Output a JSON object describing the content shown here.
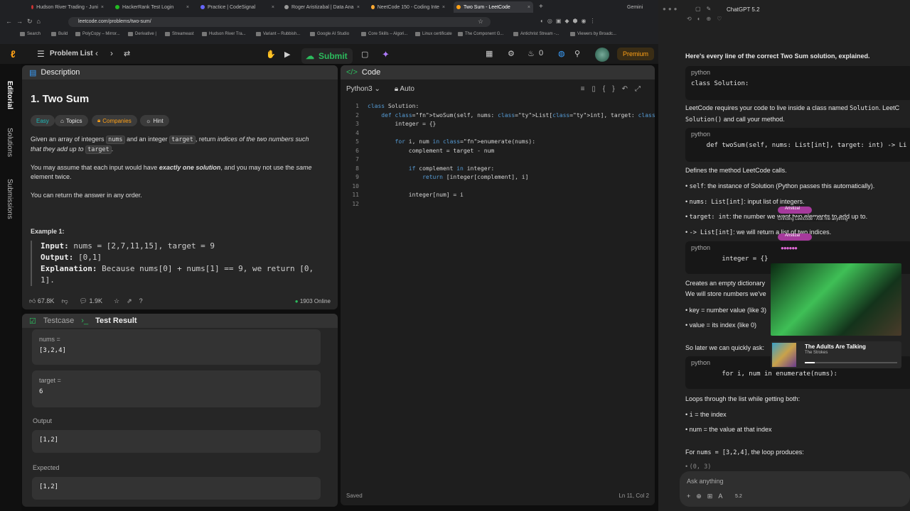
{
  "browser": {
    "tabs": [
      "Hudson River Trading - Juni",
      "HackerRank Test Login",
      "Practice | CodeSignal",
      "Roger Aristizabal | Data Ana",
      "NeetCode 150 - Coding Inte",
      "Two Sum - LeetCode"
    ],
    "extra_tab": "Gemini",
    "url": "leetcode.com/problems/two-sum/",
    "bookmarks": [
      "Search",
      "Build",
      "PolyCopy – Mirror...",
      "Derivative |",
      "Streameast",
      "Hudson River Tra...",
      "Variant – Rubbish...",
      "Google AI Studio",
      "Core Skills – Algori...",
      "Linux certificate",
      "The Component G...",
      "Antichrist Stream -...",
      "Viewers by Broadc..."
    ]
  },
  "nav": {
    "problem_list": "Problem List",
    "submit": "Submit",
    "streak": "0",
    "premium": "Premium"
  },
  "rail": {
    "editorial": "Editorial",
    "solutions": "Solutions",
    "submissions": "Submissions"
  },
  "description": {
    "tab": "Description",
    "title": "1. Two Sum",
    "tags": {
      "difficulty": "Easy",
      "topics": "Topics",
      "companies": "Companies",
      "hint": "Hint"
    },
    "p1_a": "Given an array of integers",
    "p1_nums": "nums",
    "p1_b": "and an integer",
    "p1_target": "target",
    "p1_c": ", return",
    "p1_d": "indices of the two numbers such",
    "p1_e": "that they add up to",
    "p1_target2": "target",
    "p1_f": ".",
    "p2_a": "You may assume that each input would have",
    "p2_b": "exactly one solution",
    "p2_c": ", and you may not use the",
    "p2_d": "same",
    "p2_e": "element twice.",
    "p3": "You can return the answer in any order.",
    "example_title": "Example 1:",
    "ex_input_label": "Input:",
    "ex_input": "nums = [2,7,11,15], target = 9",
    "ex_output_label": "Output:",
    "ex_output": "[0,1]",
    "ex_expl_label": "Explanation:",
    "ex_expl": "Because nums[0] + nums[1] == 9, we return [0,",
    "ex_expl2": "1].",
    "likes": "67.8K",
    "comments": "1.9K",
    "online": "1903 Online"
  },
  "tests": {
    "testcase_tab": "Testcase",
    "result_tab": "Test Result",
    "nums_label": "nums =",
    "nums_value": "[3,2,4]",
    "target_label": "target =",
    "target_value": "6",
    "output_label": "Output",
    "output_value": "[1,2]",
    "expected_label": "Expected",
    "expected_value": "[1,2]"
  },
  "code": {
    "tab": "Code",
    "language": "Python3",
    "mode": "Auto",
    "lines": [
      "class Solution:",
      "    def twoSum(self, nums: List[int], target: int) -> List[int]:",
      "        integer = {}",
      "",
      "        for i, num in enumerate(nums):",
      "            complement = target - num",
      "",
      "            if complement in integer:",
      "                return [integer[complement], i]",
      "",
      "            integer[num] = i",
      ""
    ],
    "status": "Saved",
    "cursor": "Ln 11, Col 2"
  },
  "chat": {
    "title": "ChatGPT 5.2",
    "intro": "Here's every line of the correct Two Sum solution, explained.",
    "python": "python",
    "code1": "class Solution:",
    "t1": "LeetCode requires your code to live inside a class named",
    "t1_code": "Solution",
    "t1_b": ". LeetC",
    "t1c": "Solution()",
    "t1d": "and call your method.",
    "code2": "    def twoSum(self, nums: List[int], target: int) -> Li",
    "t2": "Defines the method LeetCode calls.",
    "b1_code": "self",
    "b1": ": the instance of Solution (Python passes this automatically).",
    "b2_code": "nums: List[int]",
    "b2": ": input list of integers.",
    "b3_code": "target: int",
    "b3": ": the number we want two elements to add up to.",
    "b4_code": "-> List[int]",
    "b4": ": we will return a list of two indices.",
    "code3": "        integer = {}",
    "t3": "Creates an empty dictionary",
    "t3b": "We will store numbers we've",
    "b5": "key = number value (like 3)",
    "b6": "value = its index (like 0)",
    "t4": "So later we can quickly ask:",
    "code4": "        for i, num in enumerate(nums):",
    "t5": "Loops through the list while getting both:",
    "b7_code": "i",
    "b7": "= the index",
    "b8": "num = the value at that index",
    "t6_a": "For",
    "t6_code": "nums = [3,2,4]",
    "t6_b": ", the loop produces:",
    "t7": "(0, 3)",
    "ask": "Ask anything",
    "model": "5.2",
    "overlay_name": "Aristizal",
    "overlay_msg": "Grinding Leetcode - Ask me anything",
    "song": "The Adults Are Talking",
    "artist": "The Strokes"
  },
  "colors": {
    "accent_green": "#2cbb5d",
    "premium_orange": "#ffa116",
    "easy_teal": "#1cb8b8"
  }
}
